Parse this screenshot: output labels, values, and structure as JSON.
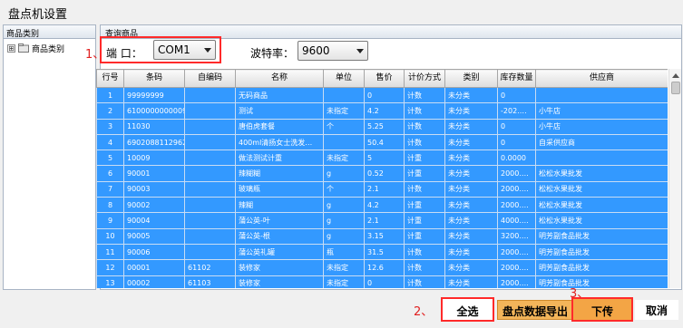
{
  "window": {
    "title": "盘点机设置"
  },
  "left_panel": {
    "header": "商品类别",
    "tree_expand": "⊞",
    "tree_item": "商品类别"
  },
  "right_panel": {
    "header": "查询商品"
  },
  "settings": {
    "port_label": "端 口：",
    "port_value": "COM1",
    "baud_label": "波特率：",
    "baud_value": "9600"
  },
  "annotations": {
    "a1": "1、",
    "a2": "2、",
    "a3": "3、"
  },
  "table": {
    "columns": [
      "行号",
      "条码",
      "自编码",
      "名称",
      "单位",
      "售价",
      "计价方式",
      "类别",
      "库存数量",
      "供应商"
    ],
    "rows": [
      [
        "1",
        "99999999",
        "",
        "无码商品",
        "",
        "0",
        "计数",
        "未分类",
        "0",
        ""
      ],
      [
        "2",
        "6100000000009",
        "",
        "测试",
        "未指定",
        "4.2",
        "计数",
        "未分类",
        "-202.…",
        "小牛店"
      ],
      [
        "3",
        "11030",
        "",
        "唐伯虎套餐",
        "个",
        "5.25",
        "计数",
        "未分类",
        "0",
        "小牛店"
      ],
      [
        "4",
        "6902088112962",
        "",
        "400ml清扬女士洗发…",
        "",
        "50.4",
        "计数",
        "未分类",
        "0",
        "自采供应商"
      ],
      [
        "5",
        "10009",
        "",
        "做法测试计重",
        "未指定",
        "5",
        "计重",
        "未分类",
        "0.0000",
        ""
      ],
      [
        "6",
        "90001",
        "",
        "辣糊糊",
        "g",
        "0.52",
        "计重",
        "未分类",
        "2000.…",
        "松松水果批发"
      ],
      [
        "7",
        "90003",
        "",
        "玻璃瓶",
        "个",
        "2.1",
        "计数",
        "未分类",
        "2000.…",
        "松松水果批发"
      ],
      [
        "8",
        "90002",
        "",
        "辣糊",
        "g",
        "4.2",
        "计重",
        "未分类",
        "2000.…",
        "松松水果批发"
      ],
      [
        "9",
        "90004",
        "",
        "蒲公英-叶",
        "g",
        "2.1",
        "计重",
        "未分类",
        "4000.…",
        "松松水果批发"
      ],
      [
        "10",
        "90005",
        "",
        "蒲公英-根",
        "g",
        "3.15",
        "计重",
        "未分类",
        "3200.…",
        "明芳副食品批发"
      ],
      [
        "11",
        "90006",
        "",
        "蒲公英礼罐",
        "瓶",
        "31.5",
        "计数",
        "未分类",
        "2000.…",
        "明芳副食品批发"
      ],
      [
        "12",
        "00001",
        "61102",
        "装修家",
        "未指定",
        "12.6",
        "计数",
        "未分类",
        "2000.…",
        "明芳副食品批发"
      ],
      [
        "13",
        "00002",
        "61103",
        "装修家",
        "未指定",
        "0",
        "计数",
        "未分类",
        "2000.…",
        "明芳副食品批发"
      ]
    ]
  },
  "buttons": {
    "select_all": "全选",
    "export": "盘点数据导出",
    "download": "下传",
    "cancel": "取消"
  },
  "colors": {
    "selection": "#3399ff",
    "highlight_border": "#ff2a2a",
    "button_orange": "#f3a545"
  }
}
